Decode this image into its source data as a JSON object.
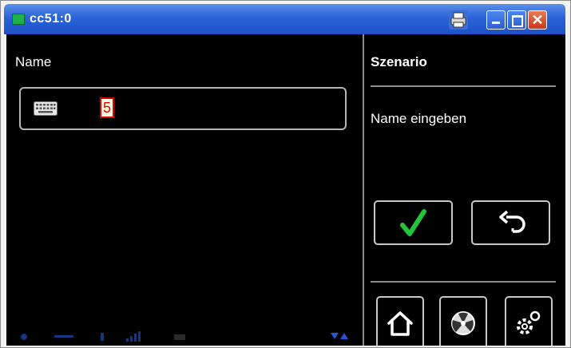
{
  "window": {
    "title": "cc51:0",
    "controls": [
      "print-icon",
      "minimize-icon",
      "maximize-icon",
      "close-icon"
    ],
    "close_glyph": "✕"
  },
  "left_panel": {
    "label": "Name",
    "input": {
      "icon": "keyboard-icon",
      "value": "5"
    }
  },
  "right_panel": {
    "title": "Szenario",
    "hint": "Name eingeben",
    "buttons": [
      "confirm-check-icon",
      "back-arrow-icon"
    ],
    "nav": [
      "home-icon",
      "fan-icon",
      "gear-icon"
    ]
  },
  "colors": {
    "screen_bg": "#000000",
    "titlebar": "#2a63d8",
    "check": "#22c43a",
    "highlight": "#e00000"
  }
}
